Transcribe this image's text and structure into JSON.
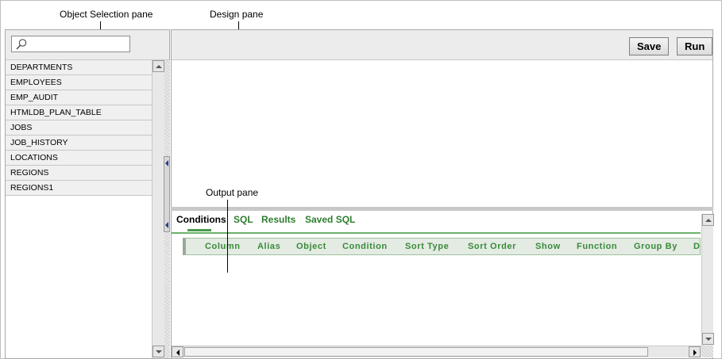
{
  "callouts": {
    "object_selection": "Object Selection pane",
    "design": "Design pane",
    "output": "Output pane"
  },
  "object_list": {
    "items": [
      "DEPARTMENTS",
      "EMPLOYEES",
      "EMP_AUDIT",
      "HTMLDB_PLAN_TABLE",
      "JOBS",
      "JOB_HISTORY",
      "LOCATIONS",
      "REGIONS",
      "REGIONS1"
    ]
  },
  "toolbar": {
    "save_label": "Save",
    "run_label": "Run"
  },
  "output": {
    "tabs": [
      "Conditions",
      "SQL",
      "Results",
      "Saved SQL"
    ],
    "active_tab": "Conditions",
    "columns": [
      "Column",
      "Alias",
      "Object",
      "Condition",
      "Sort Type",
      "Sort Order",
      "Show",
      "Function",
      "Group By",
      "D"
    ]
  },
  "colors": {
    "accent_green": "#2e7d2e",
    "header_text_green": "#3a8a3a"
  }
}
